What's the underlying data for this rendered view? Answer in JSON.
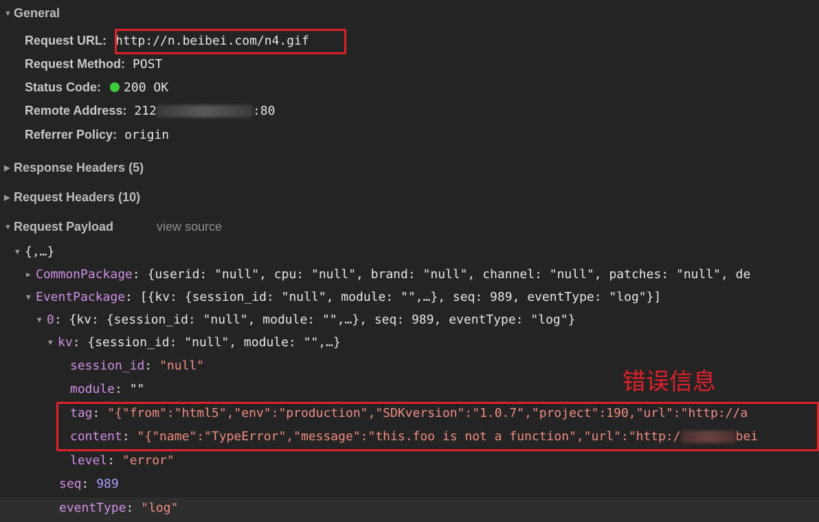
{
  "general": {
    "title": "General",
    "request_url_label": "Request URL:",
    "request_url": "http://n.beibei.com/n4.gif",
    "request_method_label": "Request Method:",
    "request_method": "POST",
    "status_code_label": "Status Code:",
    "status_code": "200 OK",
    "remote_address_label": "Remote Address:",
    "remote_address_prefix": "212",
    "remote_address_suffix": ":80",
    "referrer_policy_label": "Referrer Policy:",
    "referrer_policy": "origin"
  },
  "response_headers": {
    "title": "Response Headers (5)"
  },
  "request_headers": {
    "title": "Request Headers (10)"
  },
  "payload": {
    "title": "Request Payload",
    "view_source": "view source",
    "root": "{,…}",
    "common_key": "CommonPackage",
    "common_value": ": {userid: \"null\", cpu: \"null\", brand: \"null\", channel: \"null\", patches: \"null\", de",
    "event_key": "EventPackage",
    "event_value": ": [{kv: {session_id: \"null\", module: \"\",…}, seq: 989, eventType: \"log\"}]",
    "item0_key": "0",
    "item0_value": ": {kv: {session_id: \"null\", module: \"\",…}, seq: 989, eventType: \"log\"}",
    "kv_key": "kv",
    "kv_value": ": {session_id: \"null\", module: \"\",…}",
    "session_key": "session_id",
    "session_value": "\"null\"",
    "module_key": "module",
    "module_value": "\"\"",
    "tag_key": "tag",
    "tag_value": "\"{\"from\":\"html5\",\"env\":\"production\",\"SDKversion\":\"1.0.7\",\"project\":190,\"url\":\"http://a",
    "content_key": "content",
    "content_value_a": "\"{\"name\":\"TypeError\",\"message\":\"this.foo is not a function\",\"url\":\"http:/",
    "content_value_b": "bei",
    "level_key": "level",
    "level_value": "\"error\"",
    "seq_key": "seq",
    "seq_value": "989",
    "eventtype_key": "eventType",
    "eventtype_value": "\"log\""
  },
  "annotation": "错误信息",
  "colors": {
    "accent_red": "#e0202a",
    "status_green": "#3ccf3c",
    "key_purple": "#cf8fe6",
    "string_red": "#f28b82"
  }
}
